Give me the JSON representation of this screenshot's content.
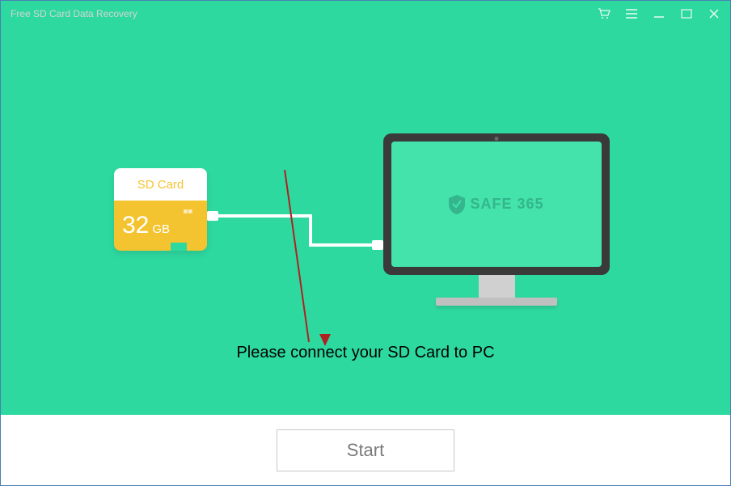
{
  "titlebar": {
    "title": "Free SD Card Data Recovery"
  },
  "sdcard": {
    "label": "SD Card",
    "capacity": "32",
    "unit": "GB"
  },
  "monitor": {
    "brand": "SAFE 365"
  },
  "instruction": "Please connect your SD Card to PC",
  "buttons": {
    "start": "Start"
  }
}
